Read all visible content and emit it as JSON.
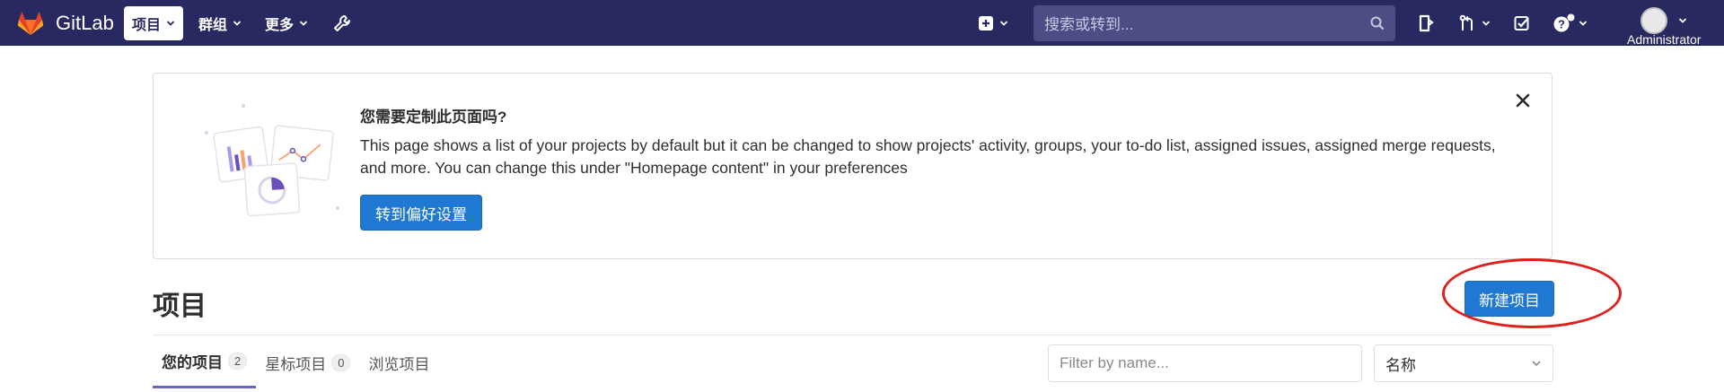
{
  "app": {
    "name": "GitLab"
  },
  "navbar": {
    "items": [
      {
        "label": "项目",
        "active": true
      },
      {
        "label": "群组",
        "active": false
      },
      {
        "label": "更多",
        "active": false
      }
    ],
    "search_placeholder": "搜索或转到...",
    "user_name": "Administrator"
  },
  "callout": {
    "title": "您需要定制此页面吗?",
    "body": "This page shows a list of your projects by default but it can be changed to show projects' activity, groups, your to-do list, assigned issues, assigned merge requests, and more. You can change this under \"Homepage content\" in your preferences",
    "button_label": "转到偏好设置"
  },
  "page": {
    "title": "项目",
    "new_project_label": "新建项目"
  },
  "tabs": [
    {
      "label": "您的项目",
      "count": "2",
      "active": true
    },
    {
      "label": "星标项目",
      "count": "0",
      "active": false
    },
    {
      "label": "浏览项目",
      "count": null,
      "active": false
    }
  ],
  "filter": {
    "placeholder": "Filter by name...",
    "sort_value": "名称"
  },
  "colors": {
    "navbar_bg": "#292961",
    "primary": "#1f78d1",
    "tab_active": "#6666c4",
    "highlight": "#e0201c"
  }
}
